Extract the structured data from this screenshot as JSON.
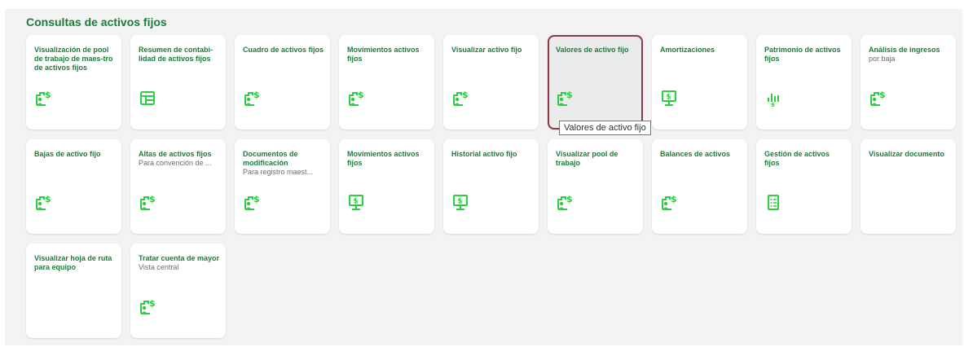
{
  "section": {
    "title": "Consultas de activos fijos"
  },
  "tiles": [
    {
      "title": "Visualización de pool de trabajo de maes-tro de activos fijos",
      "subtitle": "",
      "icon": "asset-money-icon"
    },
    {
      "title": "Resumen de contabi-lidad de activos fijos",
      "subtitle": "",
      "icon": "dashboard-icon"
    },
    {
      "title": "Cuadro de activos fijos",
      "subtitle": "",
      "icon": "asset-money-icon"
    },
    {
      "title": "Movimientos activos fijos",
      "subtitle": "",
      "icon": "asset-money-icon"
    },
    {
      "title": "Visualizar activo fijo",
      "subtitle": "",
      "icon": "asset-money-icon"
    },
    {
      "title": "Valores de activo fijo",
      "subtitle": "",
      "icon": "asset-money-icon"
    },
    {
      "title": "Amortizaciones",
      "subtitle": "",
      "icon": "monitor-money-icon"
    },
    {
      "title": "Patrimonio de activos fijos",
      "subtitle": "",
      "icon": "money-chart-icon"
    },
    {
      "title": "Análisis de ingresos",
      "subtitle": "por baja",
      "icon": "asset-money-icon"
    },
    {
      "title": "Bajas de activo fijo",
      "subtitle": "",
      "icon": "asset-money-icon"
    },
    {
      "title": "Altas de activos fijos",
      "subtitle": "Para convención de ...",
      "icon": "asset-money-icon"
    },
    {
      "title": "Documentos de modificación",
      "subtitle": "Para registro maest...",
      "icon": "asset-money-icon"
    },
    {
      "title": "Movimientos activos fijos",
      "subtitle": "",
      "icon": "monitor-money-icon"
    },
    {
      "title": "Historial activo fijo",
      "subtitle": "",
      "icon": "monitor-money-icon"
    },
    {
      "title": "Visualizar pool de trabajo",
      "subtitle": "",
      "icon": "asset-money-icon"
    },
    {
      "title": "Balances de activos",
      "subtitle": "",
      "icon": "asset-money-icon"
    },
    {
      "title": "Gestión de activos fijos",
      "subtitle": "",
      "icon": "checklist-icon"
    },
    {
      "title": "Visualizar documento",
      "subtitle": "",
      "icon": ""
    },
    {
      "title": "Visualizar hoja de ruta para equipo",
      "subtitle": "",
      "icon": ""
    },
    {
      "title": "Tratar cuenta de mayor",
      "subtitle": "Vista central",
      "icon": "asset-money-icon"
    }
  ],
  "hovered_tile": 5,
  "tooltip": {
    "text": "Valores de activo fijo"
  },
  "colors": {
    "accent": "#1c7c3a",
    "icon": "#2ecc40",
    "hover_border": "#8b3a46",
    "section_bg": "#f3f3f3"
  }
}
